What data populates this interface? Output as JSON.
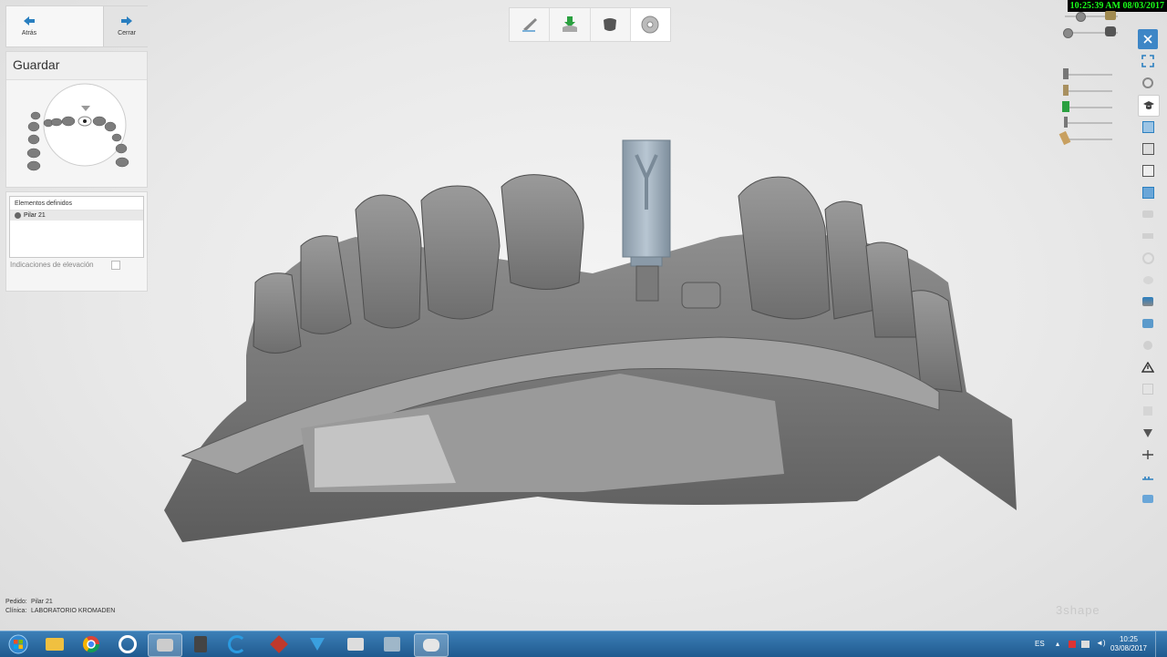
{
  "nav": {
    "back_label": "Atrás",
    "close_label": "Cerrar"
  },
  "save_panel": {
    "title": "Guardar"
  },
  "elements_panel": {
    "header": "Elementos definidos",
    "items": [
      {
        "label": "Pilar 21"
      }
    ],
    "elevation_label": "Indicaciones de elevación",
    "elevation_checked": false
  },
  "timestamp": "10:25:39 AM 08/03/2017",
  "order_info": {
    "order_label": "Pedido:",
    "order_value": "Pilar 21",
    "clinic_label": "Clínica:",
    "clinic_value": "LABORATORIO KROMADEN"
  },
  "brand": "3shape",
  "taskbar": {
    "language": "ES",
    "time": "10:25",
    "date": "03/08/2017"
  },
  "colors": {
    "accent": "#2a7fc0",
    "taskbar": "#2866a0",
    "timestamp_text": "#1aff1a"
  }
}
